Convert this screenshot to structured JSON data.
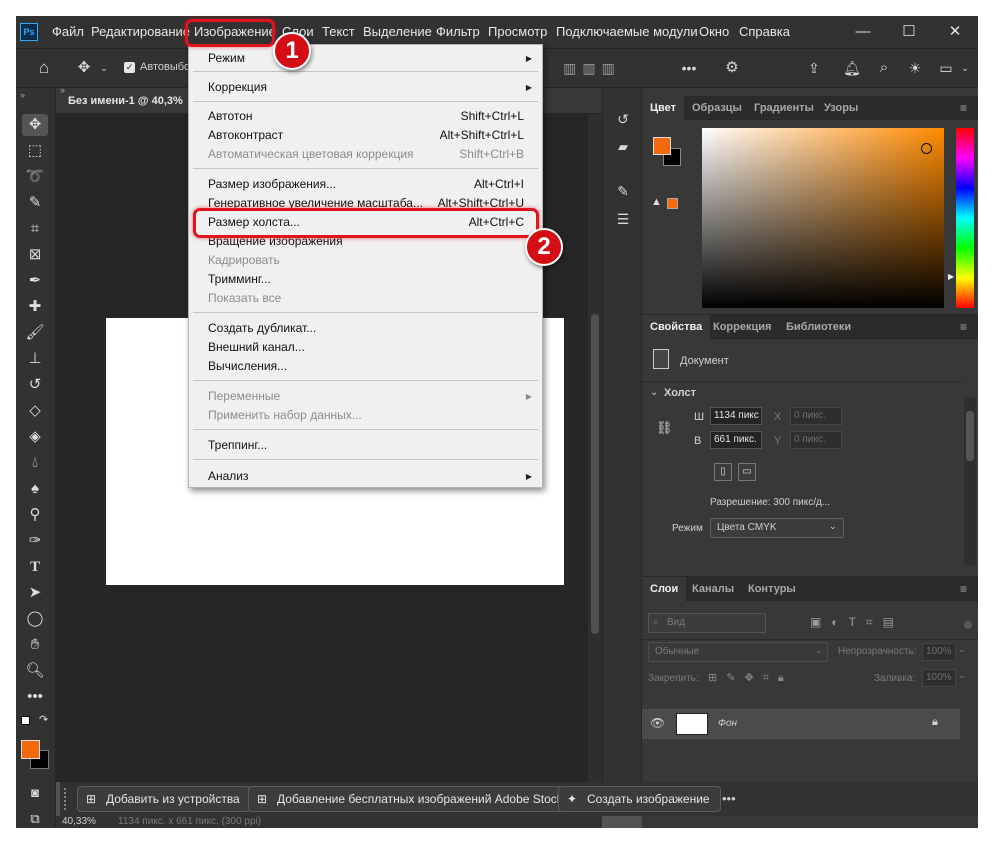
{
  "menubar": {
    "logo": "Ps",
    "items": [
      "Файл",
      "Редактирование",
      "Изображение",
      "Слои",
      "Текст",
      "Выделение",
      "Фильтр",
      "Просмотр",
      "Подключаемые модули",
      "Окно",
      "Справка"
    ]
  },
  "window_controls": {
    "minimize": "—",
    "maximize": "☐",
    "close": "✕"
  },
  "options_bar": {
    "autoselect_label": "Автовыбо"
  },
  "document": {
    "tab_title": "Без имени-1 @ 40,3%",
    "status": "40,33%",
    "status_size": "1134 пикс. x 661 пикс. (300 ppi)"
  },
  "image_menu": {
    "items": [
      {
        "label": "Режим",
        "shortcut": "",
        "submenu": true,
        "disabled": false
      },
      {
        "label": "Коррекция",
        "shortcut": "",
        "submenu": true,
        "disabled": false
      },
      {
        "label": "Автотон",
        "shortcut": "Shift+Ctrl+L",
        "submenu": false,
        "disabled": false
      },
      {
        "label": "Автоконтраст",
        "shortcut": "Alt+Shift+Ctrl+L",
        "submenu": false,
        "disabled": false
      },
      {
        "label": "Автоматическая цветовая коррекция",
        "shortcut": "Shift+Ctrl+B",
        "submenu": false,
        "disabled": true
      },
      {
        "label": "Размер изображения...",
        "shortcut": "Alt+Ctrl+I",
        "submenu": false,
        "disabled": false
      },
      {
        "label": "Генеративное увеличение масштаба...",
        "shortcut": "Alt+Shift+Ctrl+U",
        "submenu": false,
        "disabled": false
      },
      {
        "label": "Размер холста...",
        "shortcut": "Alt+Ctrl+C",
        "submenu": false,
        "disabled": false
      },
      {
        "label": "Вращение изображения",
        "shortcut": "",
        "submenu": false,
        "disabled": false
      },
      {
        "label": "Кадрировать",
        "shortcut": "",
        "submenu": false,
        "disabled": true
      },
      {
        "label": "Тримминг...",
        "shortcut": "",
        "submenu": false,
        "disabled": false
      },
      {
        "label": "Показать все",
        "shortcut": "",
        "submenu": false,
        "disabled": true
      },
      {
        "label": "Создать дубликат...",
        "shortcut": "",
        "submenu": false,
        "disabled": false
      },
      {
        "label": "Внешний канал...",
        "shortcut": "",
        "submenu": false,
        "disabled": false
      },
      {
        "label": "Вычисления...",
        "shortcut": "",
        "submenu": false,
        "disabled": false
      },
      {
        "label": "Переменные",
        "shortcut": "",
        "submenu": true,
        "disabled": true
      },
      {
        "label": "Применить набор данных...",
        "shortcut": "",
        "submenu": false,
        "disabled": true
      },
      {
        "label": "Треппинг...",
        "shortcut": "",
        "submenu": false,
        "disabled": false
      },
      {
        "label": "Анализ",
        "shortcut": "",
        "submenu": true,
        "disabled": false
      }
    ]
  },
  "callouts": {
    "step1": "1",
    "step2": "2",
    "color": "#e0141e"
  },
  "color_panel": {
    "tabs": [
      "Цвет",
      "Образцы",
      "Градиенты",
      "Узоры"
    ],
    "foreground": "#f26a0b",
    "background": "#000000"
  },
  "properties_panel": {
    "tabs": [
      "Свойства",
      "Коррекция",
      "Библиотеки"
    ],
    "doc_label": "Документ",
    "section": "Холст",
    "width_label": "Ш",
    "width_value": "1134 пикс",
    "height_label": "В",
    "height_value": "661 пикс.",
    "x_value": "0 пикс.",
    "y_value": "0 пикс.",
    "resolution": "Разрешение: 300 пикс/д...",
    "mode_label": "Режим",
    "mode_value": "Цвета CMYK"
  },
  "layers_panel": {
    "tabs": [
      "Слои",
      "Каналы",
      "Контуры"
    ],
    "filter_placeholder": "Вид",
    "blend_mode": "Обычные",
    "opacity_label": "Непрозрачность:",
    "opacity_value": "100%",
    "lock_label": "Закрепить:",
    "fill_label": "Заливка:",
    "fill_value": "100%",
    "layer_name": "Фон"
  },
  "context_bar": {
    "add_from_device": "Добавить из устройства",
    "free_stock": "Добавление бесплатных изображений Adobe Stock",
    "create_image": "Создать изображение",
    "more": "•••"
  }
}
